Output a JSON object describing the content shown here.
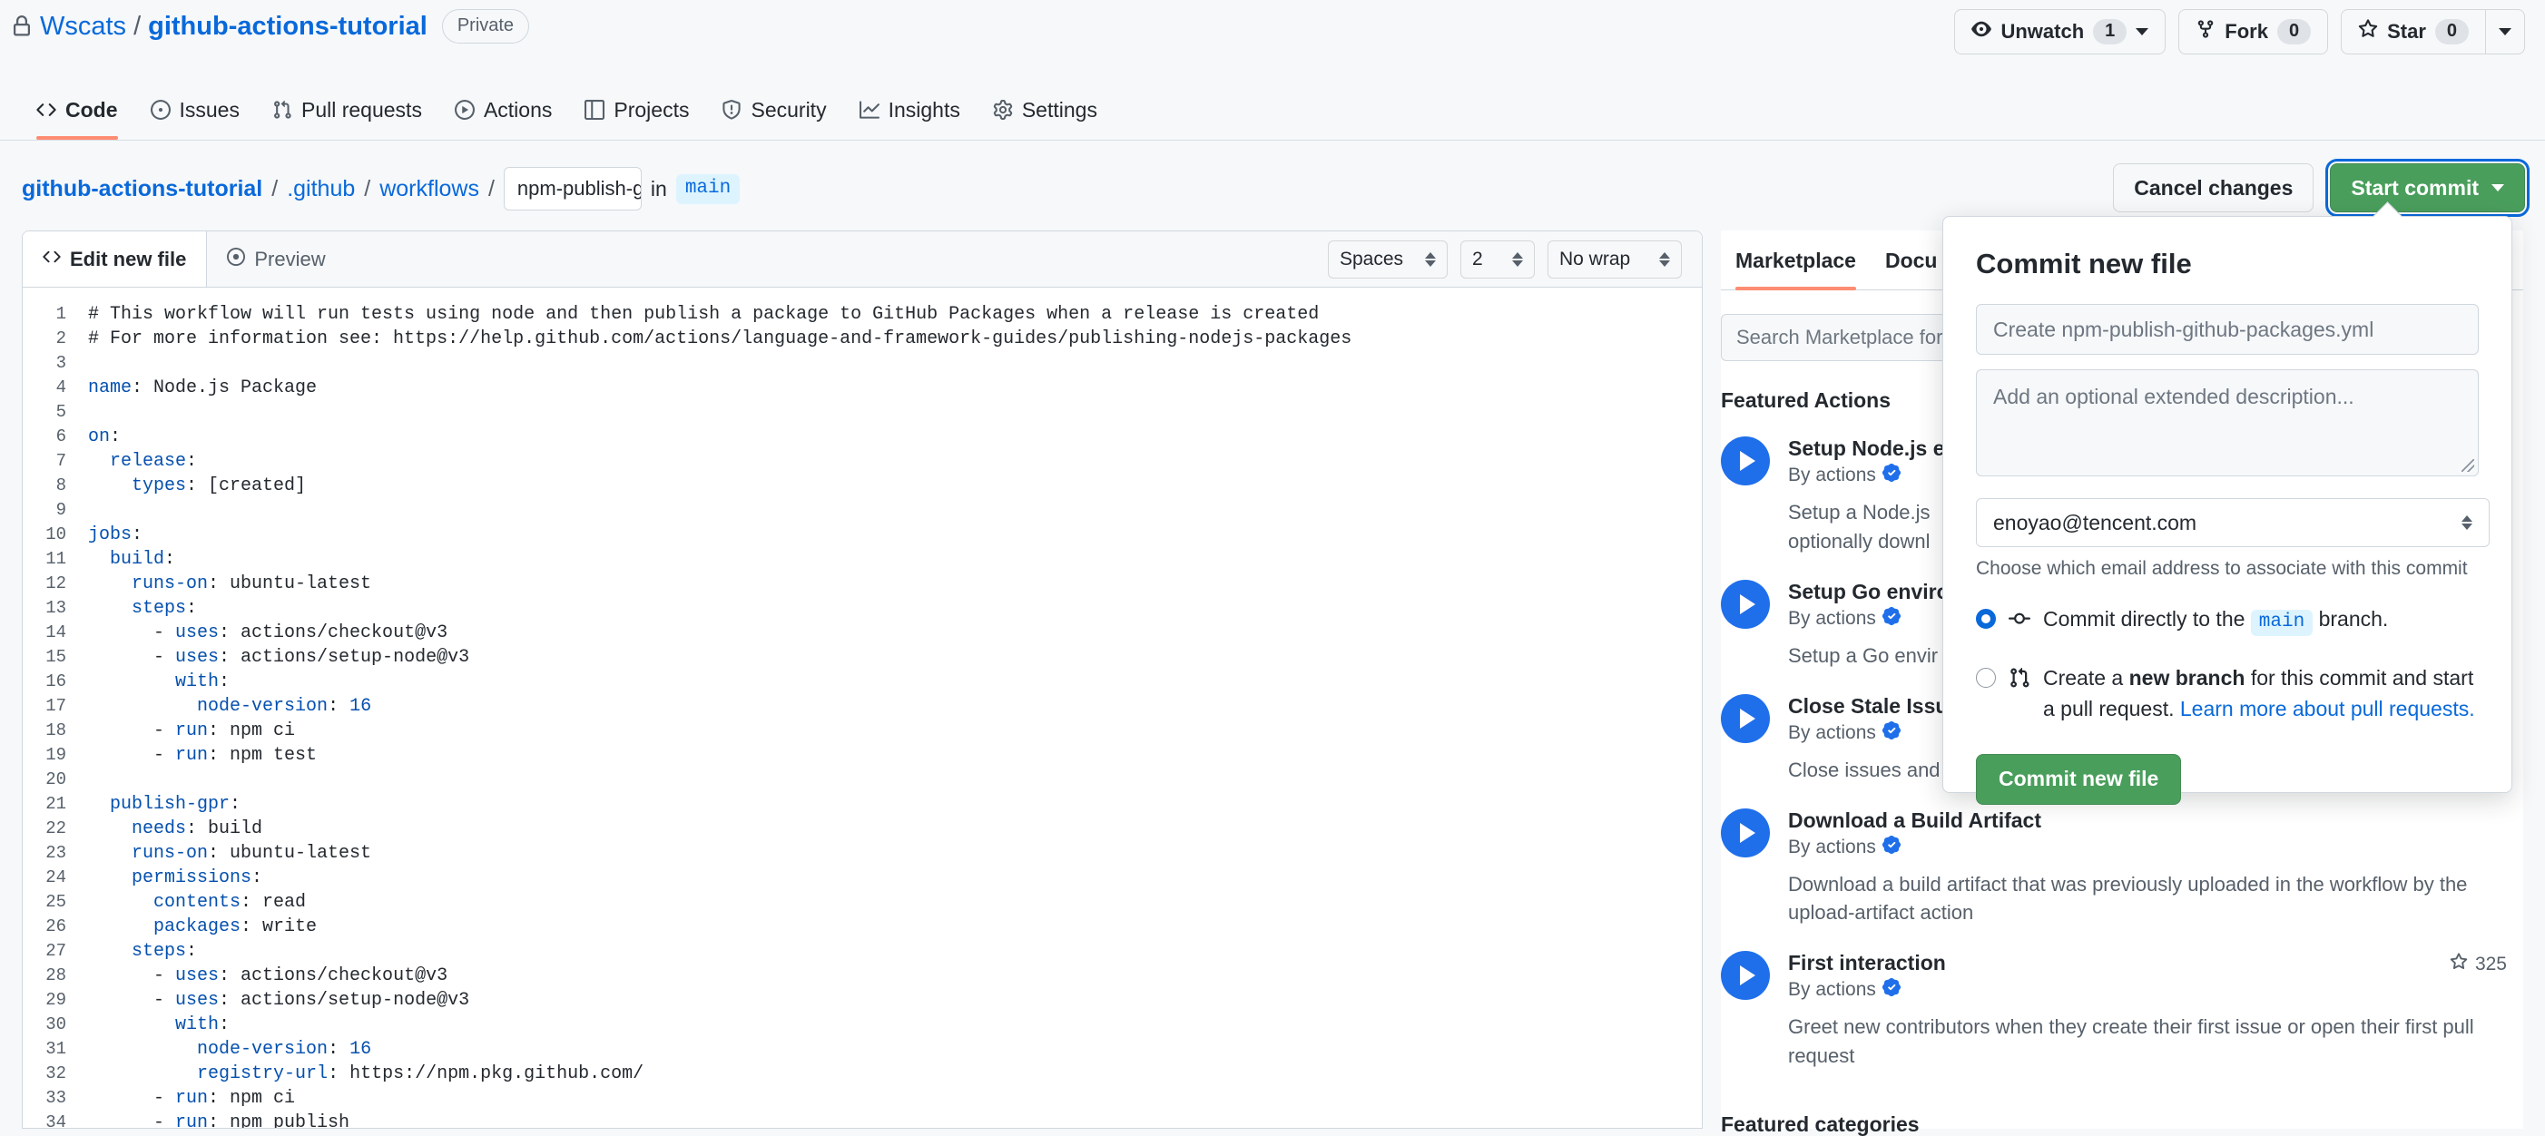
{
  "repo": {
    "owner": "Wscats",
    "separator": "/",
    "name": "github-actions-tutorial",
    "visibility": "Private",
    "lock_icon": "lock-icon"
  },
  "repo_actions": {
    "unwatch_label": "Unwatch",
    "unwatch_count": "1",
    "fork_label": "Fork",
    "fork_count": "0",
    "star_label": "Star",
    "star_count": "0"
  },
  "nav_tabs": [
    {
      "label": "Code",
      "icon": "code-icon",
      "selected": true
    },
    {
      "label": "Issues",
      "icon": "issue-opened-icon",
      "selected": false
    },
    {
      "label": "Pull requests",
      "icon": "git-pull-request-icon",
      "selected": false
    },
    {
      "label": "Actions",
      "icon": "play-icon",
      "selected": false
    },
    {
      "label": "Projects",
      "icon": "table-icon",
      "selected": false
    },
    {
      "label": "Security",
      "icon": "shield-icon",
      "selected": false
    },
    {
      "label": "Insights",
      "icon": "graph-icon",
      "selected": false
    },
    {
      "label": "Settings",
      "icon": "gear-icon",
      "selected": false
    }
  ],
  "breadcrumb": {
    "repo": "github-actions-tutorial",
    "sep1": "/",
    "dir1": ".github",
    "sep2": "/",
    "dir2": "workflows",
    "sep3": "/",
    "filename_value": "npm-publish-github-pa",
    "in_word": "in",
    "branch": "main"
  },
  "path_actions": {
    "cancel_label": "Cancel changes",
    "start_commit_label": "Start commit"
  },
  "editor": {
    "tab_edit": "Edit new file",
    "tab_preview": "Preview",
    "indent_mode": "Spaces",
    "indent_size": "2",
    "wrap_mode": "No wrap",
    "code_lines": [
      {
        "n": "1",
        "text": "# This workflow will run tests using node and then publish a package to GitHub Packages when a release is created",
        "type": "comment"
      },
      {
        "n": "2",
        "text": "# For more information see: https://help.github.com/actions/language-and-framework-guides/publishing-nodejs-packages",
        "type": "comment"
      },
      {
        "n": "3",
        "text": "",
        "type": "plain"
      },
      {
        "n": "4",
        "text": "name: Node.js Package",
        "type": "kv",
        "key": "name",
        "indent": 0
      },
      {
        "n": "5",
        "text": "",
        "type": "plain"
      },
      {
        "n": "6",
        "text": "on:",
        "type": "kv",
        "key": "on",
        "indent": 0
      },
      {
        "n": "7",
        "text": "  release:",
        "type": "kv",
        "key": "release",
        "indent": 2
      },
      {
        "n": "8",
        "text": "    types: [created]",
        "type": "kv",
        "key": "types",
        "indent": 4
      },
      {
        "n": "9",
        "text": "",
        "type": "plain"
      },
      {
        "n": "10",
        "text": "jobs:",
        "type": "kv",
        "key": "jobs",
        "indent": 0
      },
      {
        "n": "11",
        "text": "  build:",
        "type": "kv",
        "key": "build",
        "indent": 2
      },
      {
        "n": "12",
        "text": "    runs-on: ubuntu-latest",
        "type": "kv",
        "key": "runs-on",
        "indent": 4
      },
      {
        "n": "13",
        "text": "    steps:",
        "type": "kv",
        "key": "steps",
        "indent": 4
      },
      {
        "n": "14",
        "text": "      - uses: actions/checkout@v3",
        "type": "item",
        "key": "uses",
        "indent": 6
      },
      {
        "n": "15",
        "text": "      - uses: actions/setup-node@v3",
        "type": "item",
        "key": "uses",
        "indent": 6
      },
      {
        "n": "16",
        "text": "        with:",
        "type": "kv",
        "key": "with",
        "indent": 8
      },
      {
        "n": "17",
        "text": "          node-version: 16",
        "type": "kvnum",
        "key": "node-version",
        "indent": 10
      },
      {
        "n": "18",
        "text": "      - run: npm ci",
        "type": "item",
        "key": "run",
        "indent": 6
      },
      {
        "n": "19",
        "text": "      - run: npm test",
        "type": "item",
        "key": "run",
        "indent": 6
      },
      {
        "n": "20",
        "text": "",
        "type": "plain"
      },
      {
        "n": "21",
        "text": "  publish-gpr:",
        "type": "kv",
        "key": "publish-gpr",
        "indent": 2
      },
      {
        "n": "22",
        "text": "    needs: build",
        "type": "kv",
        "key": "needs",
        "indent": 4
      },
      {
        "n": "23",
        "text": "    runs-on: ubuntu-latest",
        "type": "kv",
        "key": "runs-on",
        "indent": 4
      },
      {
        "n": "24",
        "text": "    permissions:",
        "type": "kv",
        "key": "permissions",
        "indent": 4
      },
      {
        "n": "25",
        "text": "      contents: read",
        "type": "kv",
        "key": "contents",
        "indent": 6
      },
      {
        "n": "26",
        "text": "      packages: write",
        "type": "kv",
        "key": "packages",
        "indent": 6
      },
      {
        "n": "27",
        "text": "    steps:",
        "type": "kv",
        "key": "steps",
        "indent": 4
      },
      {
        "n": "28",
        "text": "      - uses: actions/checkout@v3",
        "type": "item",
        "key": "uses",
        "indent": 6
      },
      {
        "n": "29",
        "text": "      - uses: actions/setup-node@v3",
        "type": "item",
        "key": "uses",
        "indent": 6
      },
      {
        "n": "30",
        "text": "        with:",
        "type": "kv",
        "key": "with",
        "indent": 8
      },
      {
        "n": "31",
        "text": "          node-version: 16",
        "type": "kvnum",
        "key": "node-version",
        "indent": 10
      },
      {
        "n": "32",
        "text": "          registry-url: https://npm.pkg.github.com/",
        "type": "kv",
        "key": "registry-url",
        "indent": 10
      },
      {
        "n": "33",
        "text": "      - run: npm ci",
        "type": "item",
        "key": "run",
        "indent": 6
      },
      {
        "n": "34",
        "text": "      - run: npm publish",
        "type": "item",
        "key": "run",
        "indent": 6
      }
    ]
  },
  "marketplace": {
    "tab_marketplace": "Marketplace",
    "tab_documentation": "Docu",
    "search_placeholder": "Search Marketplace for",
    "featured_actions_heading": "Featured Actions",
    "featured_categories_heading": "Featured categories",
    "verified_icon": "verified-badge-icon",
    "actions": [
      {
        "title": "Setup Node.js e",
        "by": "By actions",
        "description": "Setup a Node.js\noptionally downl",
        "stars": ""
      },
      {
        "title": "Setup Go enviro",
        "by": "By actions",
        "description": "Setup a Go envir",
        "stars": ""
      },
      {
        "title": "Close Stale Issu",
        "by": "By actions",
        "description": "Close issues and",
        "stars": ""
      },
      {
        "title": "Download a Build Artifact",
        "by": "By actions",
        "description": "Download a build artifact that was previously uploaded in the workflow by the upload-artifact action",
        "stars": ""
      },
      {
        "title": "First interaction",
        "by": "By actions",
        "description": "Greet new contributors when they create their first issue or open their first pull request",
        "stars": "325"
      }
    ]
  },
  "commit_popover": {
    "title": "Commit new file",
    "message_placeholder": "Create npm-publish-github-packages.yml",
    "description_placeholder": "Add an optional extended description...",
    "email_value": "enoyao@tencent.com",
    "email_hint": "Choose which email address to associate with this commit",
    "option_direct_pre": "Commit directly to the",
    "option_direct_branch": "main",
    "option_direct_post": "branch.",
    "option_branch_pre": "Create a",
    "option_branch_bold": "new branch",
    "option_branch_post": "for this commit and start a pull request.",
    "option_branch_link": "Learn more about pull requests.",
    "submit_label": "Commit new file"
  },
  "colors": {
    "accent_blue": "#0969da",
    "green_button": "#4a9e5c",
    "tab_underline": "#fd8c73",
    "marketplace_icon": "#1f6feb"
  }
}
